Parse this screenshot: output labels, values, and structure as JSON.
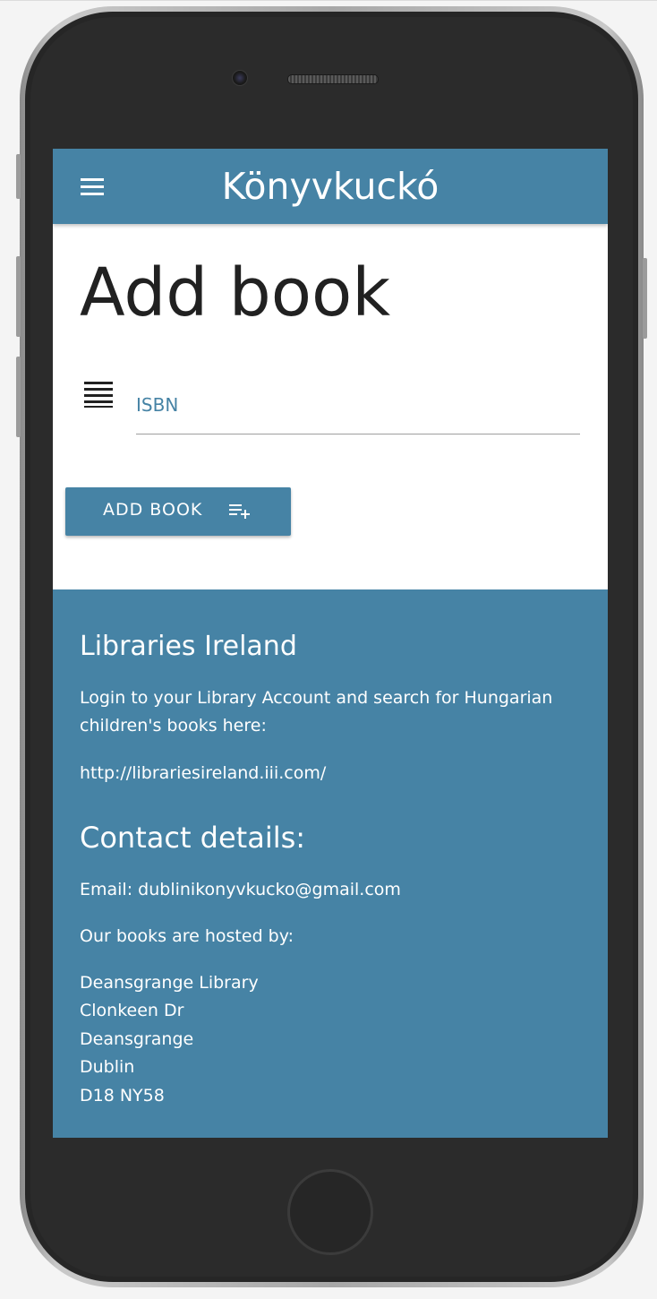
{
  "app": {
    "title": "Könyvkuckó",
    "brand_color": "#4683a5"
  },
  "header": {
    "menu_icon": "hamburger-menu-icon"
  },
  "main": {
    "page_title": "Add book",
    "isbn_field": {
      "icon": "list-icon",
      "label": "ISBN",
      "value": ""
    },
    "add_button": {
      "label": "ADD BOOK",
      "icon": "playlist-add-icon"
    }
  },
  "footer": {
    "libraries_heading": "Libraries Ireland",
    "libraries_text": "Login to your Library Account and search for Hungarian children's books here:",
    "libraries_link": "http://librariesireland.iii.com/",
    "contact_heading": "Contact details:",
    "email": "Email: dublinikonyvkucko@gmail.com",
    "hosted_by": "Our books are hosted by:",
    "address": [
      "Deansgrange Library",
      "Clonkeen Dr",
      "Deansgrange",
      "Dublin",
      "D18 NY58"
    ]
  }
}
